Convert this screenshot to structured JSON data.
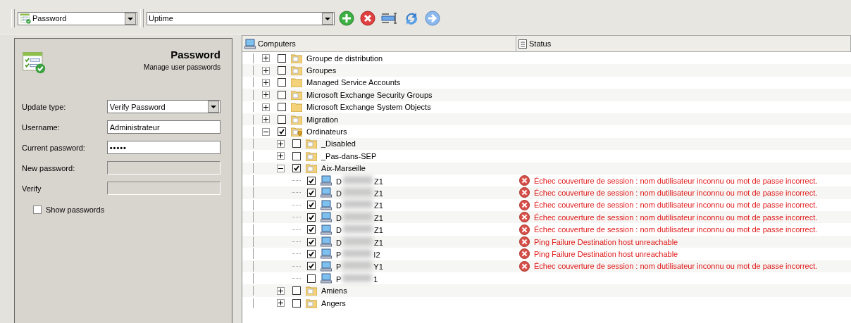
{
  "toolbar": {
    "task_combo": {
      "value": "Password"
    },
    "profile_combo": {
      "value": "Uptime"
    }
  },
  "panel": {
    "title": "Password",
    "subtitle": "Manage user passwords",
    "fields": [
      {
        "label": "Update type:",
        "kind": "dropdown",
        "value": "Verify Password",
        "disabled": false
      },
      {
        "label": "Username:",
        "kind": "text",
        "value": "Administrateur",
        "disabled": false
      },
      {
        "label": "Current password:",
        "kind": "password",
        "value": "•••••",
        "disabled": false
      },
      {
        "label": "New password:",
        "kind": "text",
        "disabled": true
      },
      {
        "label": "Verify",
        "kind": "text",
        "disabled": true
      }
    ],
    "show_passwords": {
      "label": "Show passwords",
      "checked": false
    }
  },
  "tree": {
    "columns": [
      "Computers",
      "Status"
    ],
    "items": [
      {
        "kind": "folder",
        "label": "Groupe de distribution",
        "checked": false,
        "expanded": false
      },
      {
        "kind": "folder",
        "label": "Groupes",
        "checked": false,
        "expanded": false
      },
      {
        "kind": "folder-plain",
        "label": "Managed Service Accounts",
        "checked": false,
        "expanded": false
      },
      {
        "kind": "folder",
        "label": "Microsoft Exchange Security Groups",
        "checked": false,
        "expanded": false
      },
      {
        "kind": "folder-plain",
        "label": "Microsoft Exchange System Objects",
        "checked": false,
        "expanded": false
      },
      {
        "kind": "folder",
        "label": "Migration",
        "checked": false,
        "expanded": false
      },
      {
        "kind": "folder-shield",
        "label": "Ordinateurs",
        "checked": true,
        "expanded": true,
        "children": [
          {
            "kind": "folder",
            "label": "_Disabled",
            "checked": false,
            "expanded": false
          },
          {
            "kind": "folder",
            "label": "_Pas-dans-SEP",
            "checked": false,
            "expanded": false
          },
          {
            "kind": "folder",
            "label": "Aix-Marseille",
            "checked": true,
            "expanded": true,
            "children": [
              {
                "kind": "computer",
                "name_start": "D",
                "name_end": "Z1",
                "checked": true,
                "status": "Échec couverture de session : nom dutilisateur inconnu ou mot de passe incorrect."
              },
              {
                "kind": "computer",
                "name_start": "D",
                "name_end": "Z1",
                "checked": true,
                "status": "Échec couverture de session : nom dutilisateur inconnu ou mot de passe incorrect."
              },
              {
                "kind": "computer",
                "name_start": "D",
                "name_end": "Z1",
                "checked": true,
                "status": "Échec couverture de session : nom dutilisateur inconnu ou mot de passe incorrect."
              },
              {
                "kind": "computer",
                "name_start": "D",
                "name_end": "Z1",
                "checked": true,
                "status": "Échec couverture de session : nom dutilisateur inconnu ou mot de passe incorrect."
              },
              {
                "kind": "computer",
                "name_start": "D",
                "name_end": "Z1",
                "checked": true,
                "status": "Échec couverture de session : nom dutilisateur inconnu ou mot de passe incorrect."
              },
              {
                "kind": "computer",
                "name_start": "D",
                "name_end": "Z1",
                "checked": true,
                "status": "Ping Failure Destination host unreachable"
              },
              {
                "kind": "computer",
                "name_start": "P",
                "name_end": "I2",
                "checked": true,
                "status": "Ping Failure Destination host unreachable"
              },
              {
                "kind": "computer",
                "name_start": "P",
                "name_end": "Y1",
                "checked": true,
                "status": "Échec couverture de session : nom dutilisateur inconnu ou mot de passe incorrect."
              },
              {
                "kind": "computer",
                "name_start": "P",
                "name_end": "1",
                "checked": false
              }
            ]
          },
          {
            "kind": "folder",
            "label": "Amiens",
            "checked": false,
            "expanded": false
          },
          {
            "kind": "folder",
            "label": "Angers",
            "checked": false,
            "expanded": false
          }
        ]
      }
    ]
  }
}
